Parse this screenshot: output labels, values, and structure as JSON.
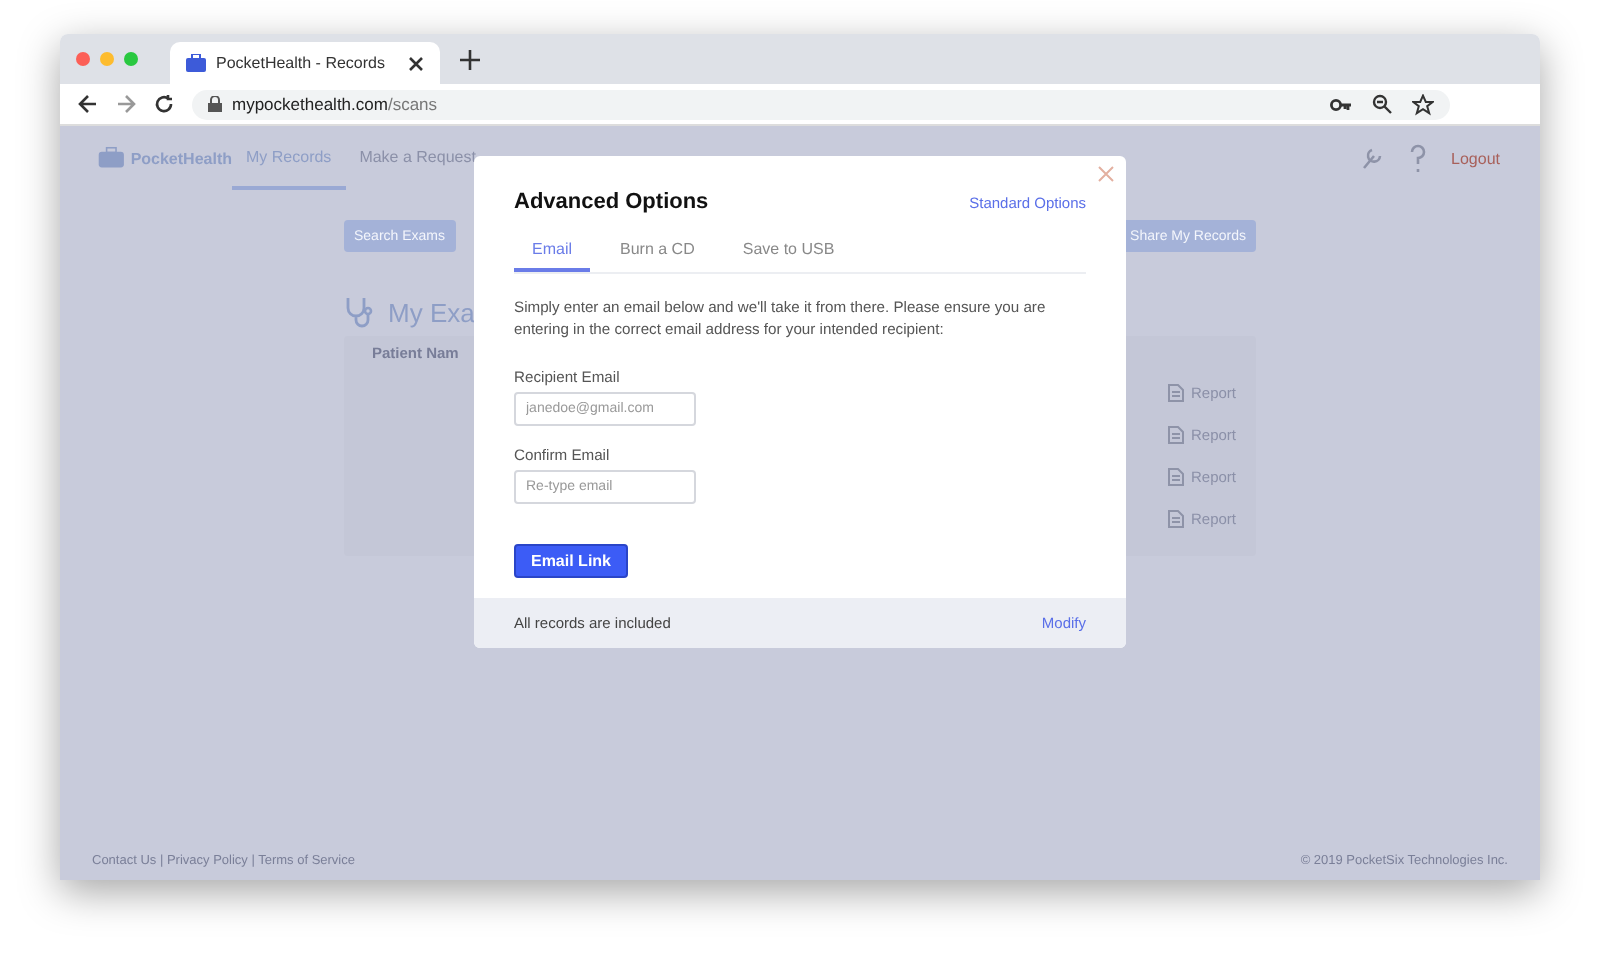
{
  "browser": {
    "tab_title": "PocketHealth - Records",
    "url_host": "mypockethealth.com",
    "url_path": "/scans"
  },
  "nav": {
    "logo": "PocketHealth",
    "items": [
      {
        "label": "My Records",
        "selected": true
      },
      {
        "label": "Make a Request",
        "selected": false
      }
    ],
    "logout": "Logout"
  },
  "toolbar": {
    "search_button": "Search Exams",
    "share_button": "Share My Records"
  },
  "exams": {
    "title": "My Exa",
    "column_1": "Patient Nam",
    "rows": [
      {
        "report": "Report"
      },
      {
        "report": "Report"
      },
      {
        "report": "Report"
      },
      {
        "report": "Report"
      }
    ]
  },
  "footer": {
    "links": "Contact Us | Privacy Policy | Terms of Service",
    "copyright": "© 2019 PocketSix Technologies Inc."
  },
  "modal": {
    "title": "Advanced Options",
    "switch_link": "Standard Options",
    "tabs": [
      {
        "label": "Email",
        "selected": true
      },
      {
        "label": "Burn a CD",
        "selected": false
      },
      {
        "label": "Save to USB",
        "selected": false
      }
    ],
    "intro": "Simply enter an email below and we'll take it from there. Please ensure you are entering in the correct email address for your intended recipient:",
    "fields": [
      {
        "label": "Recipient Email",
        "placeholder": "janedoe@gmail.com"
      },
      {
        "label": "Confirm Email",
        "placeholder": "Re-type email"
      }
    ],
    "submit": "Email Link",
    "footer_text": "All records are included",
    "footer_link": "Modify"
  }
}
